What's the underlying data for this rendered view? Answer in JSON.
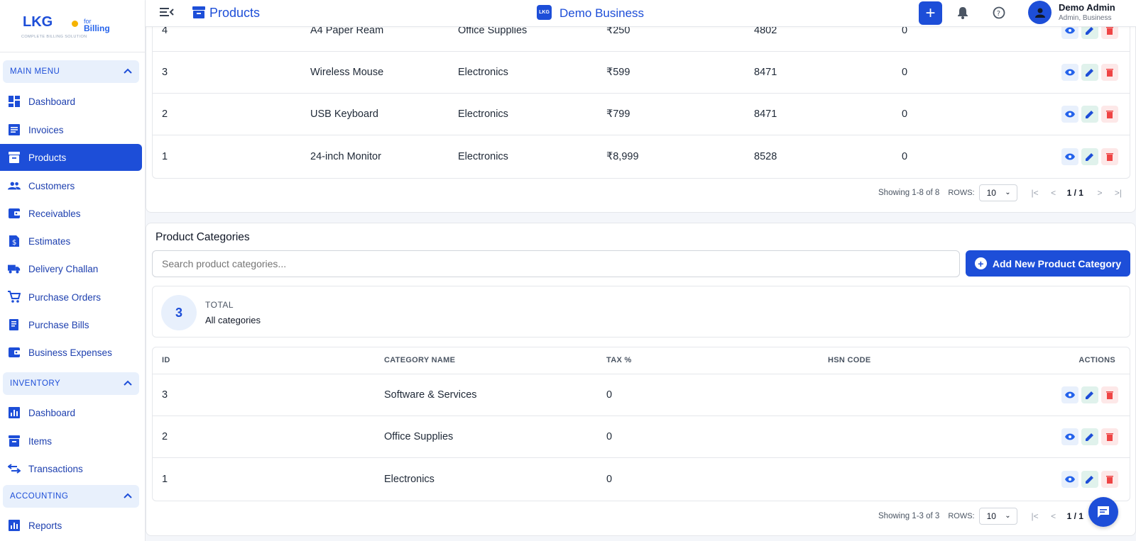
{
  "brand": {
    "logo": "LKG",
    "for": "for",
    "billing": "Billing",
    "tagline": "COMPLETE BILLING SOLUTION"
  },
  "header": {
    "title": "Products",
    "business_name": "Demo Business",
    "business_logo": "LKG",
    "user_name": "Demo Admin",
    "user_role": "Admin, Business",
    "plus": "+"
  },
  "sidebar": {
    "main_menu": "MAIN MENU",
    "main_items": [
      {
        "label": "Dashboard",
        "icon": "dashboard-icon"
      },
      {
        "label": "Invoices",
        "icon": "invoice-icon"
      },
      {
        "label": "Products",
        "icon": "archive-icon"
      },
      {
        "label": "Customers",
        "icon": "people-icon"
      },
      {
        "label": "Receivables",
        "icon": "wallet-icon"
      },
      {
        "label": "Estimates",
        "icon": "estimate-icon"
      },
      {
        "label": "Delivery Challan",
        "icon": "truck-icon"
      },
      {
        "label": "Purchase Orders",
        "icon": "cart-icon"
      },
      {
        "label": "Purchase Bills",
        "icon": "bill-icon"
      },
      {
        "label": "Business Expenses",
        "icon": "wallet-icon"
      }
    ],
    "inventory": "INVENTORY",
    "inventory_items": [
      {
        "label": "Dashboard",
        "icon": "chart-icon"
      },
      {
        "label": "Items",
        "icon": "archive-icon"
      },
      {
        "label": "Transactions",
        "icon": "swap-icon"
      }
    ],
    "accounting": "ACCOUNTING",
    "accounting_items": [
      {
        "label": "Reports",
        "icon": "chart-icon"
      }
    ],
    "active": "Products"
  },
  "products": {
    "rows": [
      {
        "id": "4",
        "name": "A4 Paper Ream",
        "category": "Office Supplies",
        "price": "₹250",
        "hsn": "4802",
        "tax": "0"
      },
      {
        "id": "3",
        "name": "Wireless Mouse",
        "category": "Electronics",
        "price": "₹599",
        "hsn": "8471",
        "tax": "0"
      },
      {
        "id": "2",
        "name": "USB Keyboard",
        "category": "Electronics",
        "price": "₹799",
        "hsn": "8471",
        "tax": "0"
      },
      {
        "id": "1",
        "name": "24-inch Monitor",
        "category": "Electronics",
        "price": "₹8,999",
        "hsn": "8528",
        "tax": "0"
      }
    ],
    "pager": {
      "showing": "Showing 1-8 of 8",
      "rows_label": "ROWS:",
      "rows_value": "10",
      "page": "1 / 1"
    }
  },
  "categories": {
    "title": "Product Categories",
    "search_placeholder": "Search product categories...",
    "add_button": "Add New Product Category",
    "stat": {
      "count": "3",
      "label": "TOTAL",
      "sub": "All categories"
    },
    "headers": {
      "id": "ID",
      "name": "CATEGORY NAME",
      "tax": "TAX %",
      "hsn": "HSN CODE",
      "actions": "ACTIONS"
    },
    "rows": [
      {
        "id": "3",
        "name": "Software & Services",
        "tax": "0",
        "hsn": ""
      },
      {
        "id": "2",
        "name": "Office Supplies",
        "tax": "0",
        "hsn": ""
      },
      {
        "id": "1",
        "name": "Electronics",
        "tax": "0",
        "hsn": ""
      }
    ],
    "pager": {
      "showing": "Showing 1-3 of 3",
      "rows_label": "ROWS:",
      "rows_value": "10",
      "page": "1 / 1"
    }
  },
  "colors": {
    "primary": "#1d4ed8",
    "view": "#2563eb",
    "edit": "#1d4ed8",
    "delete": "#ef4444"
  }
}
